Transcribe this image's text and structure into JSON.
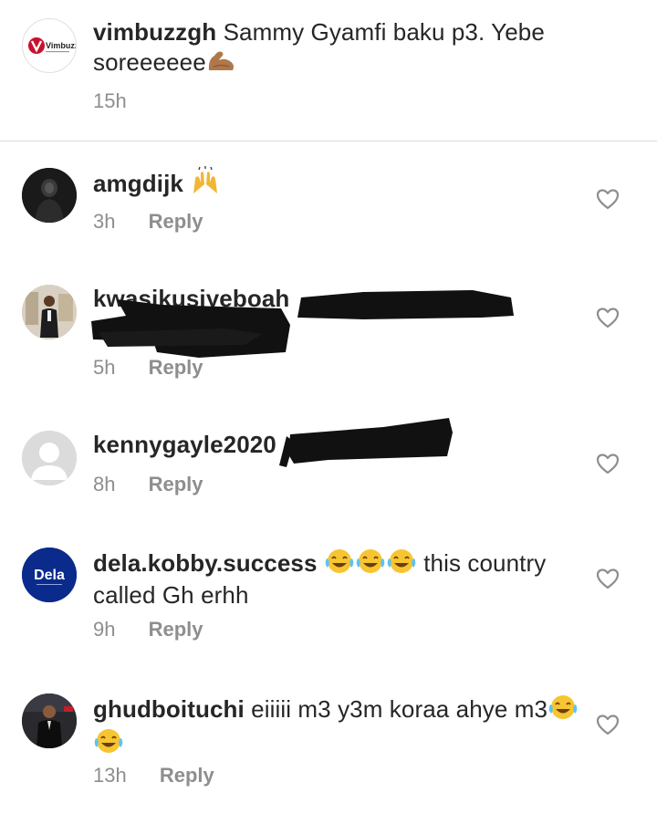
{
  "caption": {
    "username": "vimbuzzgh",
    "text": "Sammy Gyamfi baku p3. Yebe soreeeeee",
    "emoji": "flexed-biceps",
    "time": "15h",
    "avatar_logo": "Vimbuzz"
  },
  "comments": [
    {
      "username": "amgdijk",
      "text": "",
      "emoji": "raising-hands",
      "time": "3h",
      "reply_label": "Reply",
      "avatar": "dark-photo"
    },
    {
      "username": "kwasikusiyeboah",
      "text": "",
      "redacted": true,
      "time": "5h",
      "reply_label": "Reply",
      "avatar": "suited-man-photo"
    },
    {
      "username": "kennygayle2020",
      "text": "",
      "redacted": true,
      "time": "8h",
      "reply_label": "Reply",
      "avatar": "default-avatar"
    },
    {
      "username": "dela.kobby.success",
      "text": "this country called Gh erhh",
      "emoji": "face-with-tears-of-joy",
      "time": "9h",
      "reply_label": "Reply",
      "avatar_logo": "Dela",
      "avatar_color": "#0a2a8c"
    },
    {
      "username": "ghudboituchi",
      "text": "eiiiii m3 y3m koraa ahye m3",
      "emoji": "face-with-tears-of-joy",
      "time": "13h",
      "reply_label": "Reply",
      "avatar": "man-in-suit-photo"
    }
  ],
  "colors": {
    "primary_text": "#262626",
    "secondary_text": "#8e8e8e",
    "divider": "#dbdbdb",
    "heart_outline": "#8e8e8e"
  }
}
